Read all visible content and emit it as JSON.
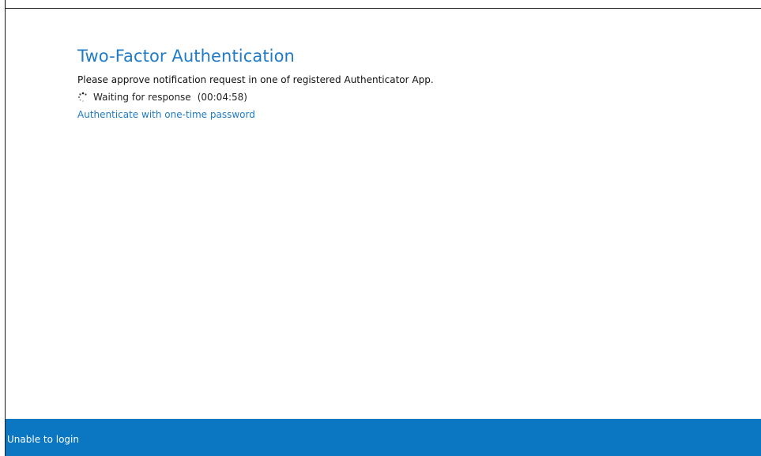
{
  "dialog": {
    "title": "Two-Factor Authentication",
    "instruction": "Please approve notification request in one of registered Authenticator App.",
    "status": {
      "icon": "spinner-icon",
      "text": "Waiting for response",
      "countdown": "(00:04:58)"
    },
    "otp_link": "Authenticate with one-time password"
  },
  "footer": {
    "link": "Unable to login",
    "background_color": "#0b77c2"
  },
  "colors": {
    "accent": "#1f7bc6"
  }
}
